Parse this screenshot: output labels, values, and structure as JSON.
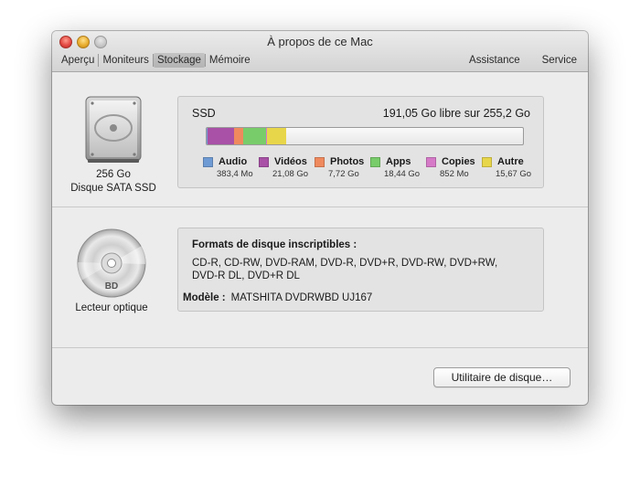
{
  "window": {
    "title": "À propos de ce Mac"
  },
  "tabs": [
    {
      "label": "Aperçu"
    },
    {
      "label": "Moniteurs"
    },
    {
      "label": "Stockage"
    },
    {
      "label": "Mémoire"
    }
  ],
  "tabs_right": [
    {
      "label": "Assistance"
    },
    {
      "label": "Service"
    }
  ],
  "ssd": {
    "capacity": "256 Go",
    "type": "Disque SATA SSD",
    "name": "SSD",
    "free_text": "191,05 Go libre sur 255,2 Go",
    "usage_bar": [
      {
        "name": "Audio",
        "fraction": 0.0015,
        "color": "#6f9bd4"
      },
      {
        "name": "Vidéos",
        "fraction": 0.0826,
        "color": "#a851a6"
      },
      {
        "name": "Photos",
        "fraction": 0.0302,
        "color": "#ef8a5e"
      },
      {
        "name": "Apps",
        "fraction": 0.0722,
        "color": "#78cc6a"
      },
      {
        "name": "Copies",
        "fraction": 0.0033,
        "color": "#d67ac8"
      },
      {
        "name": "Autre",
        "fraction": 0.0614,
        "color": "#e8d64a"
      }
    ],
    "legend": [
      {
        "label": "Audio",
        "size": "383,4 Mo",
        "color": "#6f9bd4"
      },
      {
        "label": "Vidéos",
        "size": "21,08 Go",
        "color": "#a851a6"
      },
      {
        "label": "Photos",
        "size": "7,72 Go",
        "color": "#ef8a5e"
      },
      {
        "label": "Apps",
        "size": "18,44 Go",
        "color": "#78cc6a"
      },
      {
        "label": "Copies",
        "size": "852 Mo",
        "color": "#d67ac8"
      },
      {
        "label": "Autre",
        "size": "15,67 Go",
        "color": "#e8d64a"
      }
    ]
  },
  "optical": {
    "caption": "Lecteur optique",
    "disc_label": "BD",
    "formats_title": "Formats de disque inscriptibles :",
    "formats_line1": "CD-R, CD-RW, DVD-RAM, DVD-R, DVD+R, DVD-RW, DVD+RW,",
    "formats_line2": "DVD-R DL, DVD+R DL",
    "model_label": "Modèle :",
    "model_value": "MATSHITA DVDRWBD UJ167"
  },
  "buttons": {
    "disk_utility": "Utilitaire de disque…"
  },
  "icons": {
    "hdd": "hard-drive-icon",
    "optical": "optical-disc-icon"
  }
}
